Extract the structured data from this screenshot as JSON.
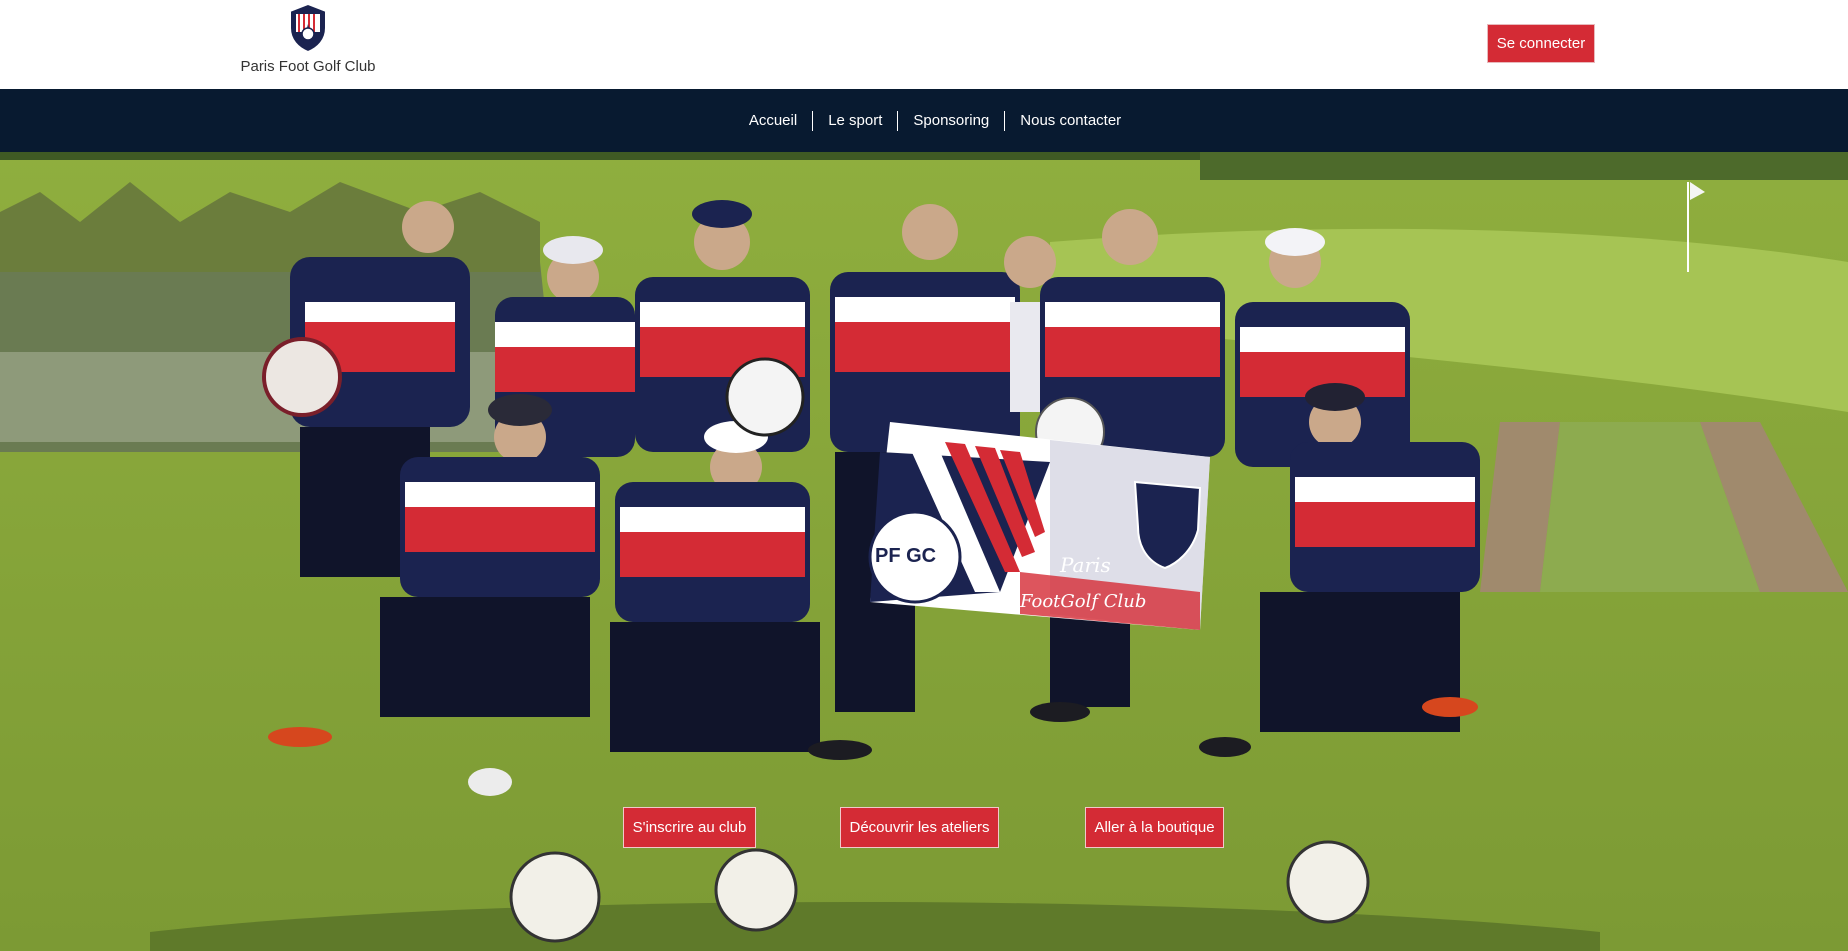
{
  "brand": {
    "name": "Paris Foot Golf Club"
  },
  "header": {
    "login_label": "Se connecter"
  },
  "nav": {
    "items": [
      {
        "label": "Accueil"
      },
      {
        "label": "Le sport"
      },
      {
        "label": "Sponsoring"
      },
      {
        "label": "Nous contacter"
      }
    ]
  },
  "hero": {
    "image": "team-photo-on-golf-course",
    "banner_text": {
      "line1": "Paris",
      "line2": "FootGolf Club",
      "letters": "PF GC"
    },
    "actions": [
      {
        "label": "S'inscrire au club"
      },
      {
        "label": "Découvrir les ateliers"
      },
      {
        "label": "Aller à la boutique"
      }
    ]
  },
  "colors": {
    "accent": "#d42b35",
    "nav_bg": "#081a30",
    "navy": "#1b2350",
    "grass": "#8aa43a"
  }
}
